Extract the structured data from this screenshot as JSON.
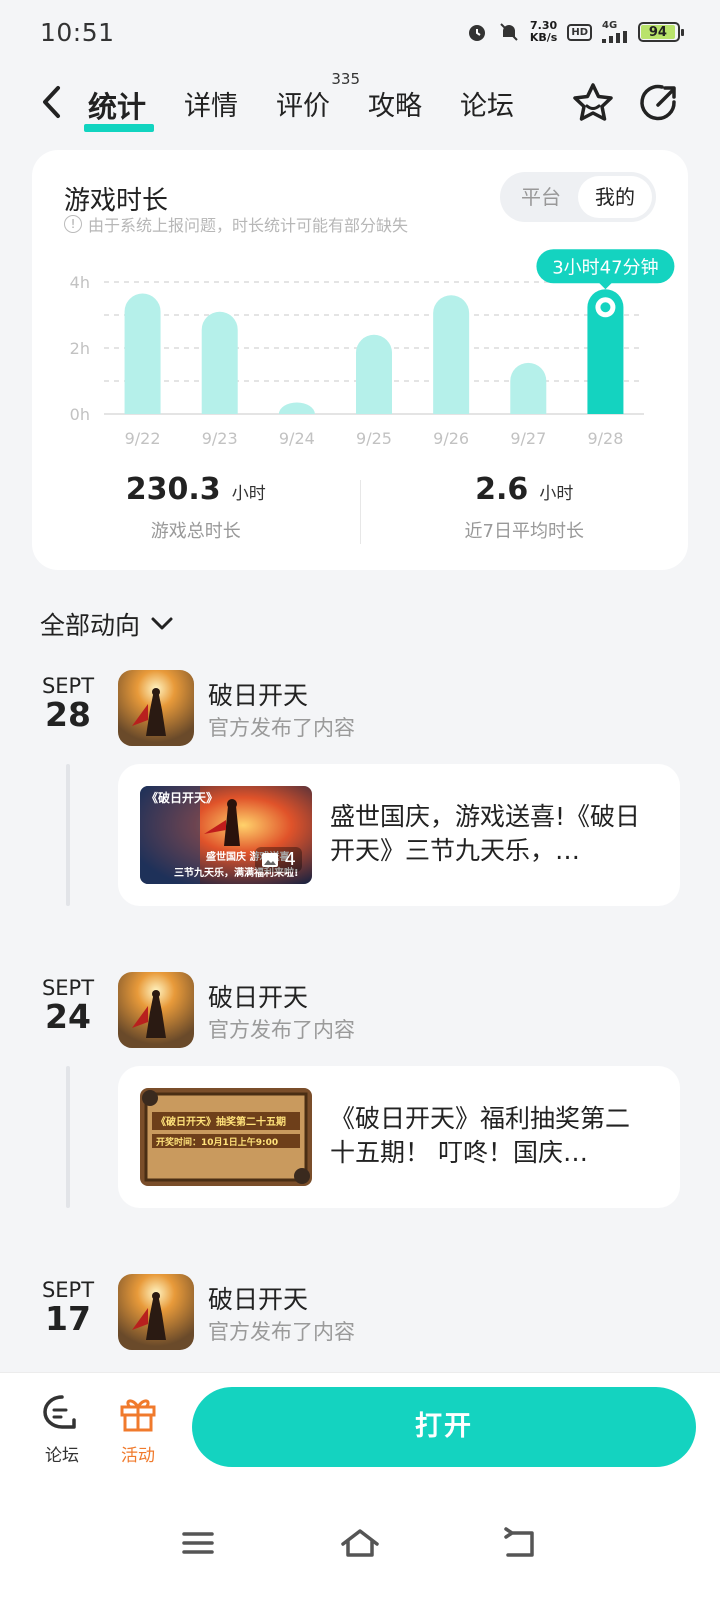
{
  "status_bar": {
    "time": "10:51",
    "net_speed_value": "7.30",
    "net_speed_unit": "KB/s",
    "hd": "HD",
    "signal": "4G",
    "battery": "94"
  },
  "nav": {
    "tabs": [
      {
        "label": "统计",
        "active": true
      },
      {
        "label": "详情"
      },
      {
        "label": "评价",
        "count": "335"
      },
      {
        "label": "攻略"
      },
      {
        "label": "论坛"
      }
    ]
  },
  "stats": {
    "title": "游戏时长",
    "notice": "由于系统上报问题，时长统计可能有部分缺失",
    "toggle": [
      "平台",
      "我的"
    ],
    "toggle_selected": "我的",
    "total_value": "230.3",
    "total_unit": "小时",
    "total_label": "游戏总时长",
    "avg_value": "2.6",
    "avg_unit": "小时",
    "avg_label": "近7日平均时长"
  },
  "chart_data": {
    "type": "bar",
    "categories": [
      "9/22",
      "9/23",
      "9/24",
      "9/25",
      "9/26",
      "9/27",
      "9/28"
    ],
    "values": [
      3.65,
      3.1,
      0.35,
      2.4,
      3.6,
      1.55,
      3.78
    ],
    "y_ticks": [
      "0h",
      "2h",
      "4h"
    ],
    "ylim": [
      0,
      4
    ],
    "highlight_index": 6,
    "highlight_label": "3小时47分钟",
    "bar_color": "#b5f0ea",
    "highlight_color": "#14d3c0",
    "grid": true
  },
  "feed": {
    "filter_label": "全部动向",
    "entries": [
      {
        "month": "SEPT",
        "day": "28",
        "game": "破日开天",
        "action": "官方发布了内容",
        "post_text": "盛世国庆，游戏送喜!《破日开天》三节九天乐，…",
        "thumb_title": "《破日开天》",
        "thumb_line1": "盛世国庆 游戏送喜!",
        "thumb_line2": "三节九天乐，满满福利来啦!",
        "image_count": "4"
      },
      {
        "month": "SEPT",
        "day": "24",
        "game": "破日开天",
        "action": "官方发布了内容",
        "post_text": "《破日开天》福利抽奖第二十五期！ 叮咚！国庆…",
        "thumb_title": "《破日开天》抽奖第二十五期",
        "thumb_line1": "开奖时间：10月1日上午9:00"
      },
      {
        "month": "SEPT",
        "day": "17",
        "game": "破日开天",
        "action": "官方发布了内容"
      }
    ]
  },
  "bottom": {
    "forum_label": "论坛",
    "activity_label": "活动",
    "open_label": "打开"
  }
}
